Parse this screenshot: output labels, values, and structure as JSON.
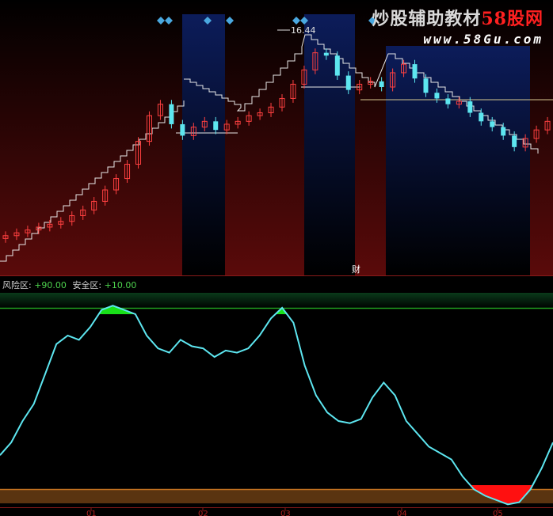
{
  "watermark": {
    "title": "炒股辅助教材",
    "brand": "58股网",
    "url": "www.58Gu.com"
  },
  "indicator": {
    "risk_label": "风险区:",
    "risk_value": "+90.00",
    "safe_label": "安全区:",
    "safe_value": "+10.00"
  },
  "price_chart": {
    "peak_annotation": "16.44",
    "marker_label": "财"
  },
  "chart_data": [
    {
      "type": "line",
      "panel": "price",
      "description_series": [
        {
          "name": "price",
          "values": [
            9.6,
            9.7,
            9.8,
            9.9,
            10.0,
            10.1,
            10.3,
            10.5,
            10.8,
            11.2,
            11.6,
            12.1,
            12.9,
            13.8,
            14.2,
            13.5,
            13.1,
            13.4,
            13.6,
            13.3,
            13.5,
            13.6,
            13.8,
            13.9,
            14.1,
            14.4,
            14.9,
            15.4,
            16.0,
            15.9,
            15.2,
            14.7,
            14.9,
            15.0,
            14.8,
            15.3,
            15.6,
            15.1,
            14.6,
            14.4,
            14.2,
            14.3,
            13.9,
            13.6,
            13.4,
            13.1,
            12.7,
            13.0,
            13.3,
            13.6
          ]
        }
      ],
      "annotations": [
        "16.44",
        "财"
      ]
    },
    {
      "type": "line",
      "panel": "oscillator",
      "reference_lines": [
        90,
        10
      ],
      "series": [
        {
          "name": "indicator",
          "x": [
            0,
            1,
            2,
            3,
            4,
            5,
            6,
            7,
            8,
            9,
            10,
            11,
            12,
            13,
            14,
            15,
            16,
            17,
            18,
            19,
            20,
            21,
            22,
            23,
            24,
            25,
            26,
            27,
            28,
            29,
            30,
            31,
            32,
            33,
            34,
            35,
            36,
            37,
            38,
            39,
            40,
            41,
            42,
            43,
            44,
            45,
            46,
            47,
            48,
            49
          ],
          "values": [
            24,
            30,
            40,
            48,
            62,
            76,
            80,
            78,
            84,
            92,
            94,
            92,
            90,
            80,
            74,
            72,
            78,
            75,
            74,
            70,
            73,
            72,
            74,
            80,
            88,
            93,
            86,
            66,
            52,
            44,
            40,
            39,
            41,
            51,
            58,
            52,
            40,
            34,
            28,
            25,
            22,
            14,
            8,
            5,
            3,
            1,
            2,
            8,
            18,
            30
          ]
        }
      ],
      "ylim": [
        0,
        100
      ]
    }
  ],
  "xaxis": {
    "ticks": [
      "01",
      "02",
      "03",
      "04",
      "05"
    ]
  }
}
